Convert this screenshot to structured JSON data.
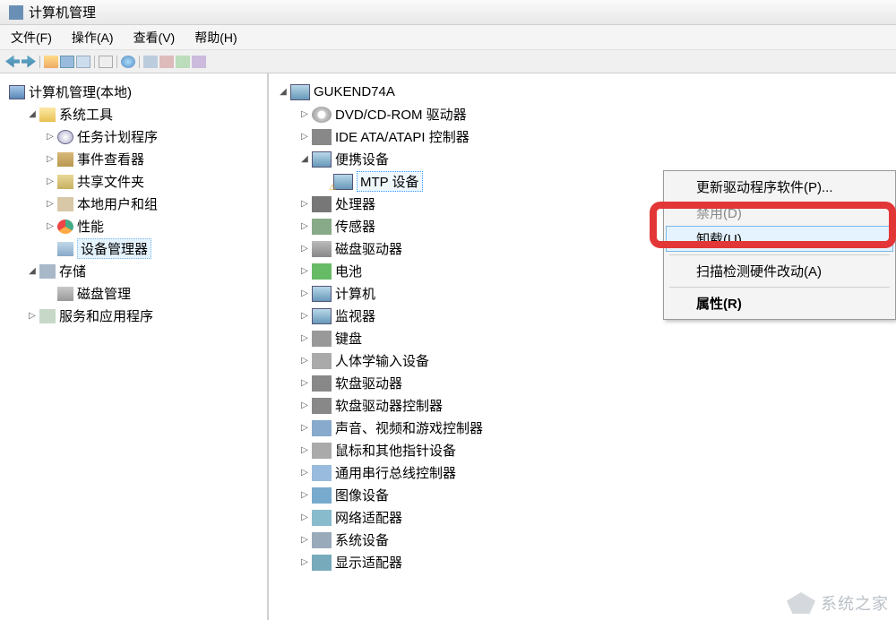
{
  "title": "计算机管理",
  "menu": {
    "file": "文件(F)",
    "action": "操作(A)",
    "view": "查看(V)",
    "help": "帮助(H)"
  },
  "left_tree": {
    "root": "计算机管理(本地)",
    "sys": "系统工具",
    "task": "任务计划程序",
    "event": "事件查看器",
    "share": "共享文件夹",
    "users": "本地用户和组",
    "perf": "性能",
    "device": "设备管理器",
    "storage": "存储",
    "disk": "磁盘管理",
    "service": "服务和应用程序"
  },
  "right_tree": {
    "root": "GUKEND74A",
    "dvd": "DVD/CD-ROM 驱动器",
    "ide": "IDE ATA/ATAPI 控制器",
    "portable": "便携设备",
    "mtp": "MTP 设备",
    "cpu": "处理器",
    "sensor": "传感器",
    "disk": "磁盘驱动器",
    "battery": "电池",
    "computer": "计算机",
    "monitor": "监视器",
    "keyboard": "键盘",
    "hid": "人体学输入设备",
    "floppy": "软盘驱动器",
    "floppyctrl": "软盘驱动器控制器",
    "sound": "声音、视频和游戏控制器",
    "mouse": "鼠标和其他指针设备",
    "usb": "通用串行总线控制器",
    "image": "图像设备",
    "network": "网络适配器",
    "system": "系统设备",
    "display": "显示适配器"
  },
  "context_menu": {
    "update": "更新驱动程序软件(P)...",
    "disable": "禁用(D)",
    "uninstall": "卸载(U)",
    "scan": "扫描检测硬件改动(A)",
    "properties": "属性(R)"
  },
  "watermark": "系统之家"
}
